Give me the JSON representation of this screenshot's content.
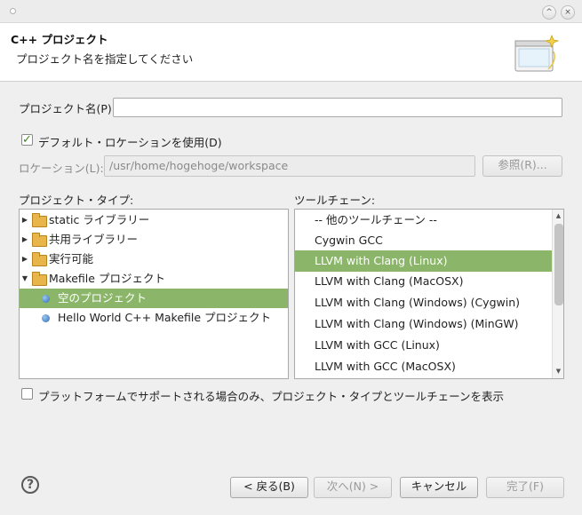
{
  "window": {
    "minimize_glyph": "^",
    "close_glyph": "×"
  },
  "header": {
    "title": "C++ プロジェクト",
    "subtitle": "プロジェクト名を指定してください",
    "icon": "wizard-banner-icon"
  },
  "project_name": {
    "label": "プロジェクト名(P):",
    "value": ""
  },
  "default_location": {
    "checked": true,
    "label": "デフォルト・ロケーションを使用(D)"
  },
  "location": {
    "label": "ロケーション(L):",
    "value": "/usr/home/hogehoge/workspace",
    "browse_label": "参照(R)..."
  },
  "project_types": {
    "header": "プロジェクト・タイプ:",
    "items": [
      {
        "label": "static ライブラリー",
        "kind": "folder",
        "expanded": false,
        "depth": 0
      },
      {
        "label": "共用ライブラリー",
        "kind": "folder",
        "expanded": false,
        "depth": 0
      },
      {
        "label": "実行可能",
        "kind": "folder",
        "expanded": false,
        "depth": 0
      },
      {
        "label": "Makefile プロジェクト",
        "kind": "folder",
        "expanded": true,
        "depth": 0
      },
      {
        "label": "空のプロジェクト",
        "kind": "item",
        "selected": true,
        "depth": 1
      },
      {
        "label": "Hello World C++ Makefile プロジェクト",
        "kind": "item",
        "depth": 1
      }
    ]
  },
  "toolchains": {
    "header": "ツールチェーン:",
    "items": [
      "-- 他のツールチェーン --",
      "Cygwin GCC",
      "LLVM with Clang (Linux)",
      "LLVM with Clang (MacOSX)",
      "LLVM with Clang (Windows) (Cygwin)",
      "LLVM with Clang (Windows) (MinGW)",
      "LLVM with GCC (Linux)",
      "LLVM with GCC (MacOSX)"
    ],
    "selected_index": 2
  },
  "platform_filter": {
    "checked": false,
    "label": "プラットフォームでサポートされる場合のみ、プロジェクト・タイプとツールチェーンを表示"
  },
  "buttons": {
    "back": "< 戻る(B)",
    "next": "次へ(N) >",
    "cancel": "キャンセル",
    "finish": "完了(F)"
  },
  "help": {
    "glyph": "?"
  }
}
